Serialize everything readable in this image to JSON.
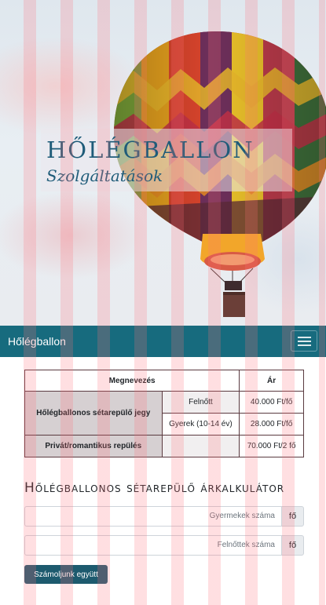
{
  "hero": {
    "title": "HŐLÉGBALLON",
    "subtitle": "Szolgáltatások"
  },
  "navbar": {
    "brand": "Hőlégballon",
    "toggler_icon": "hamburger-icon"
  },
  "price_table": {
    "headers": [
      "Megnevezés",
      "Ár"
    ],
    "rows": [
      {
        "name": "Hőlégballonos sétarepülő jegy",
        "variant": "Felnőtt",
        "price": "40.000 Ft/fő"
      },
      {
        "name": "",
        "variant": "Gyerek (10-14 év)",
        "price": "28.000 Ft/fő"
      },
      {
        "name": "Privát/romantikus repülés",
        "variant": "",
        "price": "70.000 Ft/2 fő"
      }
    ]
  },
  "calculator": {
    "title": "Hőlégballonos sétarepülő árkalkulátor",
    "children_placeholder": "Gyermekek száma",
    "adults_placeholder": "Felnőttek száma",
    "unit": "fő",
    "submit_label": "Számoljunk együtt"
  },
  "colors": {
    "navbar": "#176b7e",
    "title": "#1f5c79",
    "button": "#1d5a6e"
  }
}
